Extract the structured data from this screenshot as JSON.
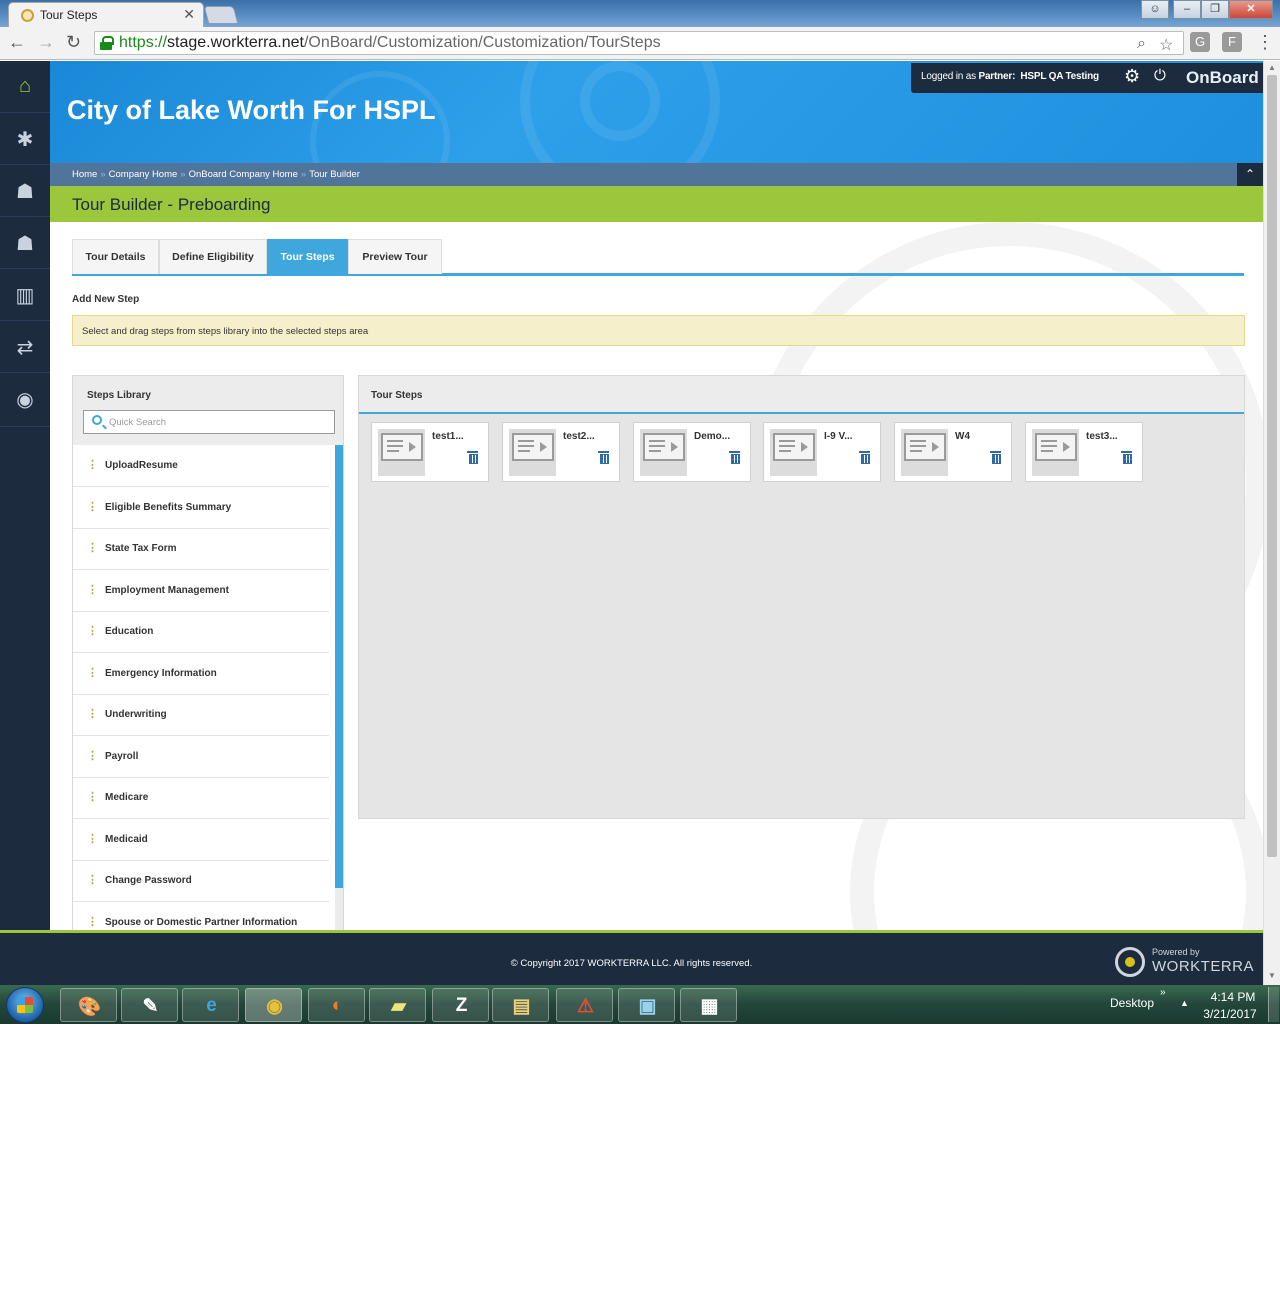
{
  "browser": {
    "tab_title": "Tour Steps",
    "url_protocol": "https://",
    "url_host": "stage.workterra.net",
    "url_path": "/OnBoard/Customization/Customization/TourSteps",
    "extensions": [
      "G",
      "F"
    ]
  },
  "app_nav": {
    "items": [
      {
        "icon": "home-icon",
        "glyph": "⌂"
      },
      {
        "icon": "puzzle-icon",
        "glyph": "✱"
      },
      {
        "icon": "user-star-icon",
        "glyph": "☗"
      },
      {
        "icon": "user-icon",
        "glyph": "☗"
      },
      {
        "icon": "bar-chart-icon",
        "glyph": "▥"
      },
      {
        "icon": "transfer-arrows-icon",
        "glyph": "⇄"
      },
      {
        "icon": "chat-icon",
        "glyph": "◉"
      }
    ]
  },
  "header": {
    "company_name": "City of Lake Worth For HSPL",
    "login_prefix": "Logged in as",
    "login_role": "Partner:",
    "login_partner": "HSPL QA Testing",
    "brand": "OnBoard",
    "breadcrumb": [
      "Home",
      "Company Home",
      "OnBoard Company Home",
      "Tour Builder"
    ]
  },
  "page": {
    "title": "Tour Builder - Preboarding",
    "tabs": [
      {
        "label": "Tour Details",
        "active": false
      },
      {
        "label": "Define Eligibility",
        "active": false
      },
      {
        "label": "Tour Steps",
        "active": true
      },
      {
        "label": "Preview Tour",
        "active": false
      }
    ],
    "section_label": "Add New Step",
    "info_text": "Select and drag steps from steps library into the selected steps area"
  },
  "library": {
    "title": "Steps Library",
    "search_placeholder": "Quick Search",
    "items": [
      "UploadResume",
      "Eligible Benefits Summary",
      "State Tax Form",
      "Employment Management",
      "Education",
      "Emergency Information",
      "Underwriting",
      "Payroll",
      "Medicare",
      "Medicaid",
      "Change Password",
      "Spouse or Domestic Partner Information"
    ]
  },
  "tour_steps": {
    "title": "Tour Steps",
    "steps": [
      "test1...",
      "test2...",
      "Demo...",
      "I-9 V...",
      "W4",
      "test3..."
    ]
  },
  "footer": {
    "copyright": "© Copyright 2017 WORKTERRA LLC. All rights reserved.",
    "powered_by": "Powered by",
    "powered_brand": "WORKTERRA"
  },
  "taskbar": {
    "desktop_label": "Desktop",
    "time": "4:14 PM",
    "date": "3/21/2017"
  },
  "colors": {
    "nav_dark": "#1c2b3e",
    "header_blue": "#1a88d6",
    "accent_green": "#9cc63b",
    "tab_active_blue": "#3fa7dd",
    "banner_yellow": "#f6efcb"
  }
}
